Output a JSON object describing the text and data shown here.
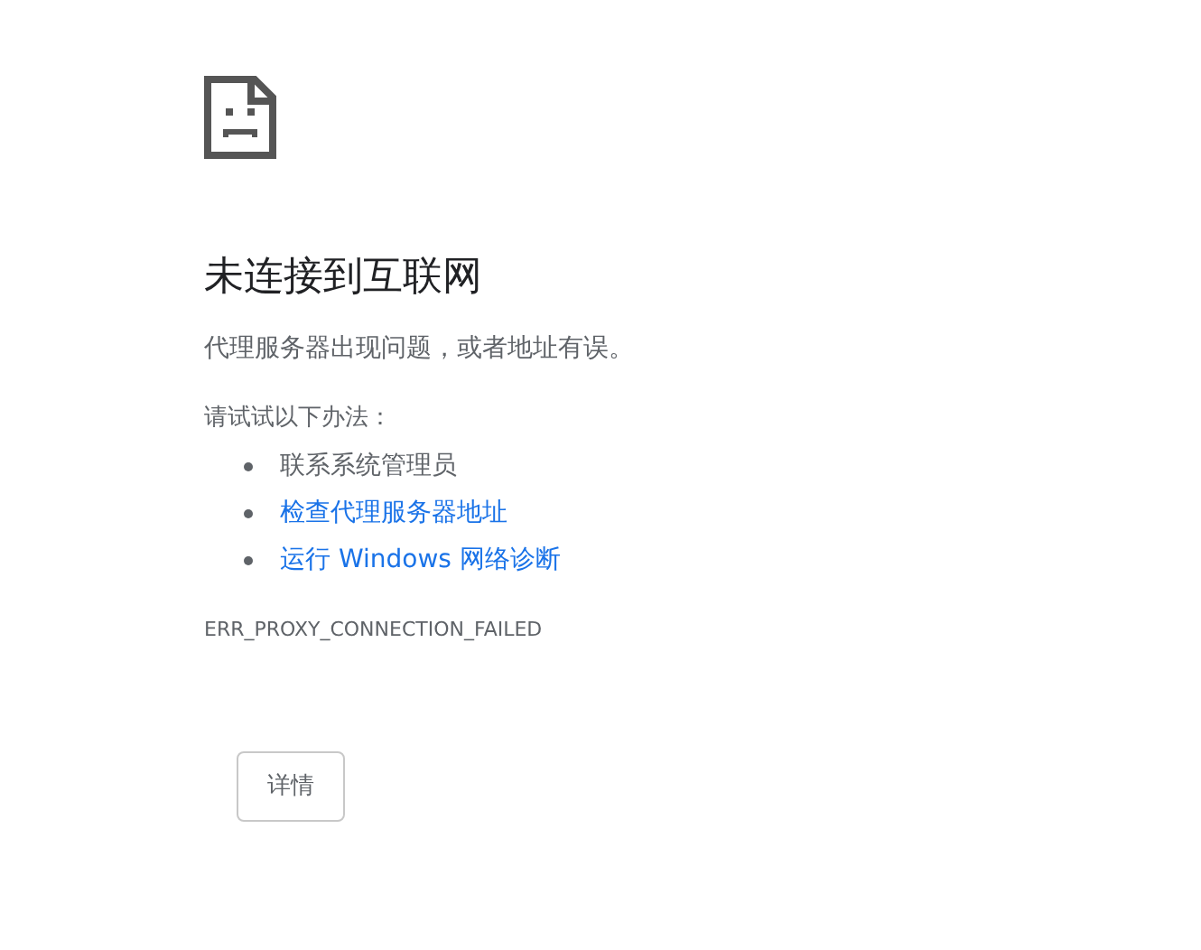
{
  "heading": "未连接到互联网",
  "summary": "代理服务器出现问题，或者地址有误。",
  "suggestions_title": "请试试以下办法：",
  "suggestions": [
    {
      "kind": "text",
      "text": "联系系统管理员"
    },
    {
      "kind": "link",
      "text": "检查代理服务器地址"
    },
    {
      "kind": "link",
      "text": "运行 Windows 网络诊断"
    }
  ],
  "error_code": "ERR_PROXY_CONNECTION_FAILED",
  "details_button": "详情"
}
